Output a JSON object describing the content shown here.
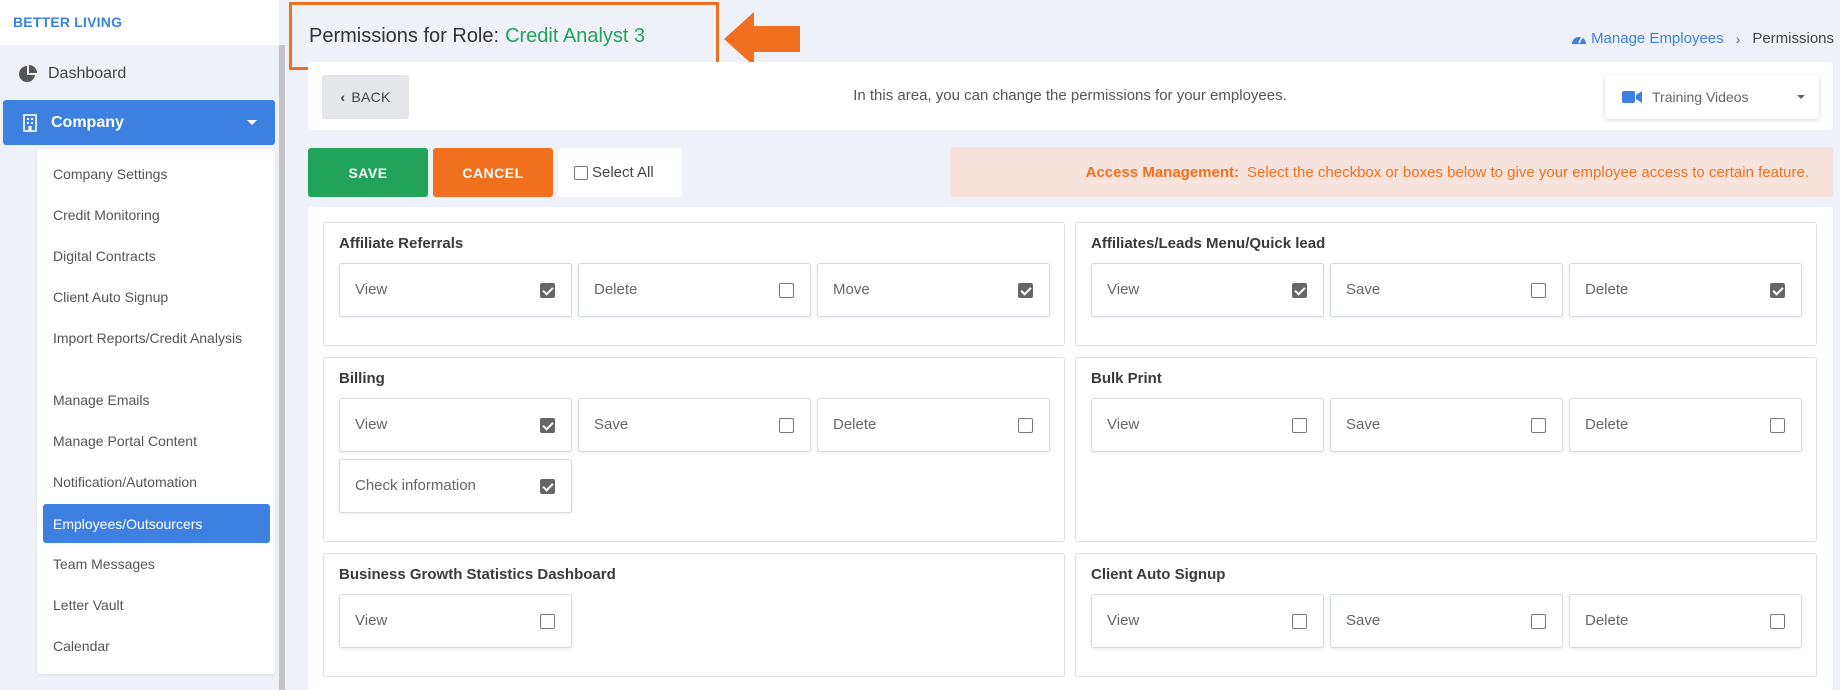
{
  "brand": "BETTER LIVING",
  "sidebar": {
    "dashboard_label": "Dashboard",
    "company_label": "Company",
    "sub_items": [
      "Company Settings",
      "Credit Monitoring",
      "Digital Contracts",
      "Client Auto Signup",
      "Import Reports/Credit Analysis",
      "Manage Emails",
      "Manage Portal Content",
      "Notification/Automation",
      "Employees/Outsourcers",
      "Team Messages",
      "Letter Vault",
      "Calendar"
    ],
    "active_sub_item": "Employees/Outsourcers"
  },
  "header": {
    "title_prefix": "Permissions for Role:",
    "role_name": "Credit Analyst 3"
  },
  "breadcrumb": {
    "link": "Manage Employees",
    "current": "Permissions"
  },
  "topbar": {
    "back_label": "BACK",
    "info": "In this area, you can change the permissions for your employees.",
    "training_label": "Training Videos"
  },
  "actions": {
    "save": "SAVE",
    "cancel": "CANCEL",
    "select_all": "Select All"
  },
  "access": {
    "title": "Access Management:",
    "text": "Select the checkbox or boxes below to give your employee access to certain feature."
  },
  "colors": {
    "accent": "#3d80e0",
    "success": "#21a35a",
    "warning": "#f07020"
  },
  "permission_groups": [
    {
      "title": "Affiliate Referrals",
      "items": [
        {
          "label": "View",
          "checked": true
        },
        {
          "label": "Delete",
          "checked": false
        },
        {
          "label": "Move",
          "checked": true
        }
      ]
    },
    {
      "title": "Affiliates/Leads Menu/Quick lead",
      "items": [
        {
          "label": "View",
          "checked": true
        },
        {
          "label": "Save",
          "checked": false
        },
        {
          "label": "Delete",
          "checked": true
        }
      ]
    },
    {
      "title": "Billing",
      "items": [
        {
          "label": "View",
          "checked": true
        },
        {
          "label": "Save",
          "checked": false
        },
        {
          "label": "Delete",
          "checked": false
        },
        {
          "label": "Check information",
          "checked": true
        }
      ]
    },
    {
      "title": "Bulk Print",
      "items": [
        {
          "label": "View",
          "checked": false
        },
        {
          "label": "Save",
          "checked": false
        },
        {
          "label": "Delete",
          "checked": false
        }
      ]
    },
    {
      "title": "Business Growth Statistics Dashboard",
      "items": [
        {
          "label": "View",
          "checked": false
        }
      ]
    },
    {
      "title": "Client Auto Signup",
      "items": [
        {
          "label": "View",
          "checked": false
        },
        {
          "label": "Save",
          "checked": false
        },
        {
          "label": "Delete",
          "checked": false
        }
      ]
    }
  ]
}
